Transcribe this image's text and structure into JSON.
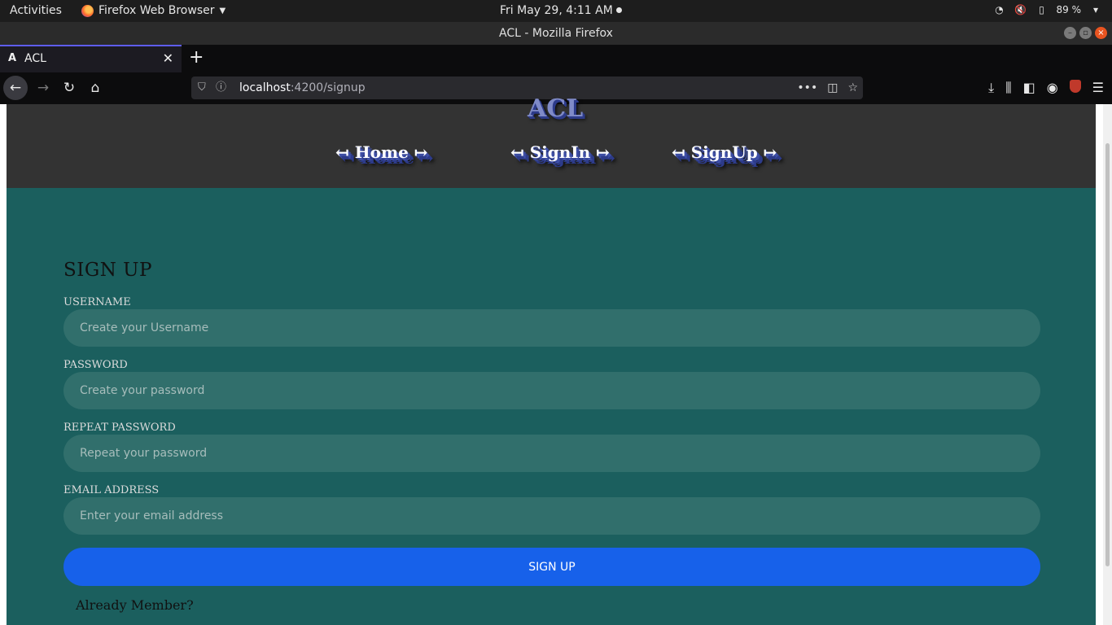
{
  "system": {
    "activities": "Activities",
    "app_name": "Firefox Web Browser",
    "clock": "Fri May 29,  4:11 AM",
    "battery": "89 %"
  },
  "window": {
    "title": "ACL - Mozilla Firefox"
  },
  "tabs": [
    {
      "label": "ACL",
      "favicon": "A"
    }
  ],
  "toolbar": {
    "url_host": "localhost",
    "url_path": ":4200/signup"
  },
  "site": {
    "logo": "ACL",
    "nav": [
      {
        "label": "↤ Home ↦"
      },
      {
        "label": "↤ SignIn ↦"
      },
      {
        "label": "↤ SignUp ↦"
      }
    ]
  },
  "form": {
    "title": "SIGN UP",
    "fields": [
      {
        "label": "USERNAME",
        "placeholder": "Create your Username",
        "value": ""
      },
      {
        "label": "PASSWORD",
        "placeholder": "Create your password",
        "value": ""
      },
      {
        "label": "REPEAT PASSWORD",
        "placeholder": "Repeat your password",
        "value": ""
      },
      {
        "label": "EMAIL ADDRESS",
        "placeholder": "Enter your email address",
        "value": ""
      }
    ],
    "submit_label": "SIGN UP",
    "member_text": "Already Member?"
  },
  "colors": {
    "page_bg": "#1b5f5e",
    "header_bg": "#333333",
    "input_bg": "#316f6c",
    "button_bg": "#1761ea"
  }
}
